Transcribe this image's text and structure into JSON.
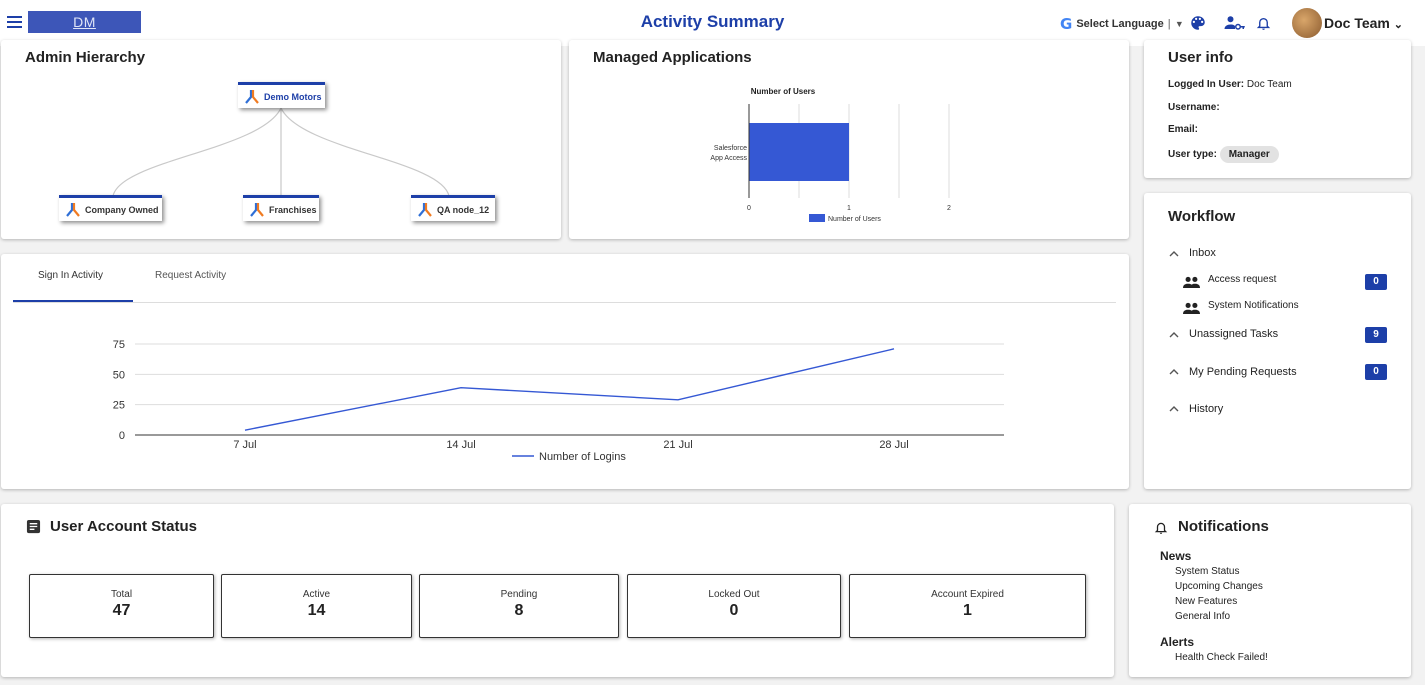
{
  "header": {
    "logo_text": "DM",
    "title": "Activity Summary",
    "language_label": "Select Language",
    "user_name": "Doc Team",
    "accent_color": "#1d3fa8"
  },
  "admin_hierarchy": {
    "title": "Admin Hierarchy",
    "root": "Demo Motors",
    "children": [
      "Company Owned",
      "Franchises",
      "QA node_12"
    ]
  },
  "managed_apps": {
    "title": "Managed Applications"
  },
  "user_info": {
    "title": "User info",
    "logged_in_label": "Logged In User:",
    "logged_in_value": "Doc Team",
    "username_label": "Username:",
    "email_label": "Email:",
    "user_type_label": "User type:",
    "user_type_value": "Manager"
  },
  "activity_tabs": {
    "tabs": [
      "Sign In Activity",
      "Request Activity"
    ],
    "active": "Sign In Activity"
  },
  "workflow": {
    "title": "Workflow",
    "inbox_label": "Inbox",
    "access_request_label": "Access request",
    "access_request_count": "0",
    "system_notifications_label": "System Notifications",
    "unassigned_label": "Unassigned Tasks",
    "unassigned_count": "9",
    "pending_label": "My Pending Requests",
    "pending_count": "0",
    "history_label": "History"
  },
  "account_status": {
    "title": "User Account Status",
    "items": [
      {
        "label": "Total",
        "value": "47"
      },
      {
        "label": "Active",
        "value": "14"
      },
      {
        "label": "Pending",
        "value": "8"
      },
      {
        "label": "Locked Out",
        "value": "0"
      },
      {
        "label": "Account Expired",
        "value": "1"
      }
    ]
  },
  "notifications": {
    "title": "Notifications",
    "news_label": "News",
    "news": [
      "System Status",
      "Upcoming Changes",
      "New Features",
      "General Info"
    ],
    "alerts_label": "Alerts",
    "alerts": [
      "Health Check Failed!"
    ]
  },
  "chart_data": [
    {
      "type": "bar",
      "orientation": "horizontal",
      "title": "Number of Users",
      "categories": [
        "Salesforce App Access"
      ],
      "series": [
        {
          "name": "Number of Users",
          "values": [
            1
          ],
          "color": "#3558d4"
        }
      ],
      "xlim": [
        0,
        2
      ],
      "x_ticks": [
        "0",
        "1",
        "2"
      ],
      "legend": "bottom",
      "grid": true
    },
    {
      "type": "line",
      "title": "",
      "x": [
        "7 Jul",
        "14 Jul",
        "21 Jul",
        "28 Jul"
      ],
      "series": [
        {
          "name": "Number of Logins",
          "values": [
            4,
            39,
            29,
            71
          ],
          "color": "#3558d4"
        }
      ],
      "ylim": [
        0,
        75
      ],
      "y_ticks": [
        "0",
        "25",
        "50",
        "75"
      ],
      "legend": "bottom",
      "grid": true
    }
  ]
}
